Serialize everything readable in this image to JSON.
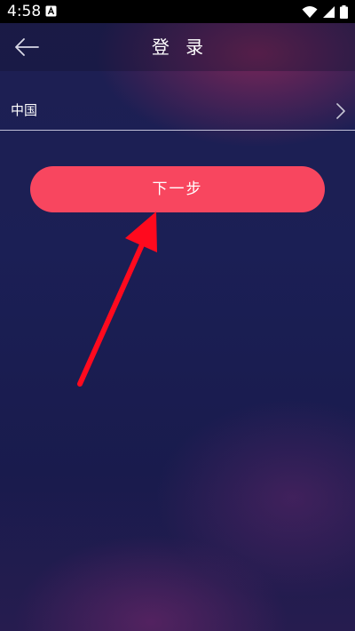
{
  "status_bar": {
    "time": "4:58",
    "icons": [
      "a-notification-icon",
      "wifi-icon",
      "signal-icon",
      "battery-icon"
    ]
  },
  "header": {
    "title": "登 录",
    "back_icon": "arrow-left-icon"
  },
  "country": {
    "label": "中国",
    "chevron_icon": "chevron-right-icon"
  },
  "next_button": {
    "label": "下一步",
    "color": "#f8465f"
  },
  "annotation": {
    "arrow_color": "#ff0a1e"
  }
}
